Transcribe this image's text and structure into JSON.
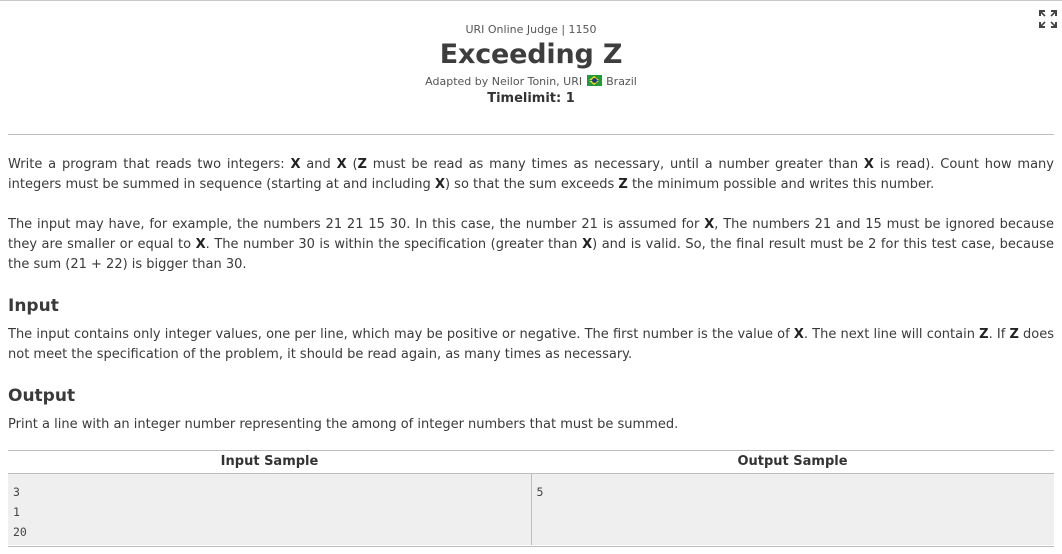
{
  "header": {
    "crumb": "URI Online Judge | 1150",
    "title": "Exceeding Z",
    "author_prefix": "Adapted by Neilor Tonin, URI",
    "country": "Brazil",
    "timelimit": "Timelimit: 1"
  },
  "icons": {
    "expand": "fullscreen-expand-icon",
    "flag": "brazil-flag-icon"
  },
  "description": {
    "p1": [
      {
        "t": "Write a program that reads two integers: "
      },
      {
        "t": "X",
        "b": true
      },
      {
        "t": " and "
      },
      {
        "t": "X",
        "b": true
      },
      {
        "t": " ("
      },
      {
        "t": "Z",
        "b": true
      },
      {
        "t": " must be read as many times as necessary, until a number greater than "
      },
      {
        "t": "X",
        "b": true
      },
      {
        "t": " is read). Count how many integers must be summed in sequence (starting at and including "
      },
      {
        "t": "X",
        "b": true
      },
      {
        "t": ") so that the sum exceeds "
      },
      {
        "t": "Z",
        "b": true
      },
      {
        "t": " the minimum possible and writes this number."
      }
    ],
    "p2": [
      {
        "t": "The input may have, for example, the numbers 21 21 15 30. In this case, the number 21 is assumed for "
      },
      {
        "t": "X",
        "b": true
      },
      {
        "t": ", The numbers 21 and 15 must be ignored because they are smaller or equal to "
      },
      {
        "t": "X",
        "b": true
      },
      {
        "t": ". The number 30 is within the specification (greater than "
      },
      {
        "t": "X",
        "b": true
      },
      {
        "t": ") and is valid. So, the final result must be 2 for this test case, because the sum (21 + 22) is bigger than 30."
      }
    ]
  },
  "input": {
    "heading": "Input",
    "text": [
      {
        "t": "The input contains only integer values, one per line, which may be positive or negative. The first number is the value of "
      },
      {
        "t": "X",
        "b": true
      },
      {
        "t": ". The next line will contain "
      },
      {
        "t": "Z",
        "b": true
      },
      {
        "t": ". If "
      },
      {
        "t": "Z",
        "b": true
      },
      {
        "t": " does not meet the specification of the problem, it should be read again, as many times as necessary."
      }
    ]
  },
  "output": {
    "heading": "Output",
    "text": "Print a line with an integer number representing the among of integer numbers that must be summed."
  },
  "samples": {
    "input_header": "Input Sample",
    "output_header": "Output Sample",
    "input_lines": [
      "3",
      "1",
      "20"
    ],
    "output_lines": [
      "5"
    ]
  }
}
